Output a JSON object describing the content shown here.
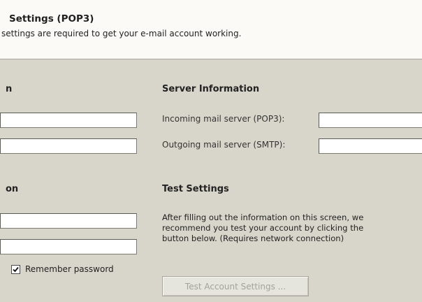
{
  "header": {
    "title": "Settings (POP3)",
    "subtitle": "settings are required to get your e-mail account working."
  },
  "left": {
    "section1_title_fragment": "n",
    "section2_title_fragment": "on",
    "fields": [
      {
        "value": ""
      },
      {
        "value": ""
      },
      {
        "value": ""
      },
      {
        "value": ""
      }
    ],
    "remember_password": {
      "label": "Remember password",
      "checked": true
    }
  },
  "server_info": {
    "title": "Server Information",
    "incoming_label": "Incoming mail server (POP3):",
    "incoming_value": "",
    "outgoing_label": "Outgoing mail server (SMTP):",
    "outgoing_value": ""
  },
  "test_settings": {
    "title": "Test Settings",
    "description_lines": [
      "After filling out the information on this screen, we",
      "recommend you test your account by clicking the",
      "button below. (Requires network connection)"
    ],
    "button_label": "Test Account Settings ..."
  }
}
